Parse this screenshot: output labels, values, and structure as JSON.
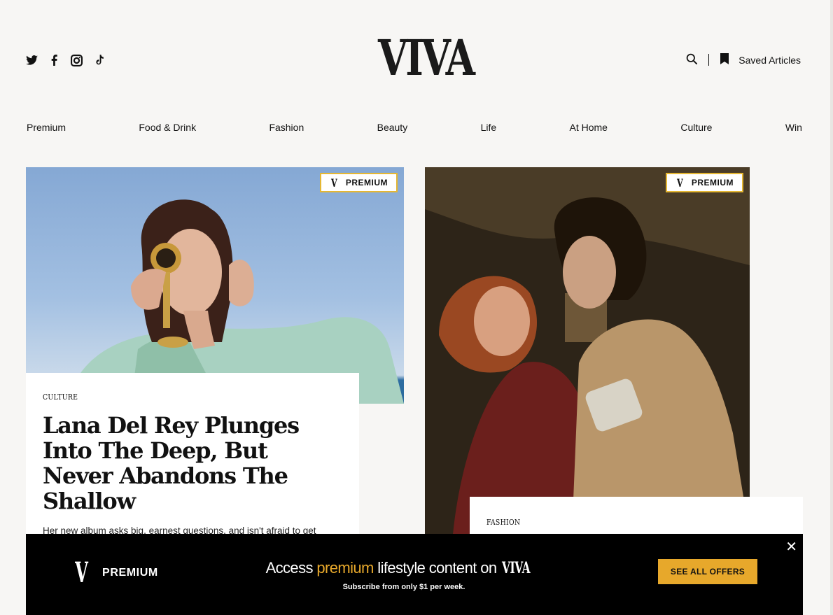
{
  "header": {
    "logo": "VIVA",
    "social_icons": [
      "twitter-icon",
      "facebook-icon",
      "instagram-icon",
      "tiktok-icon"
    ],
    "saved_articles_label": "Saved Articles"
  },
  "nav": {
    "items": [
      {
        "label": "Premium"
      },
      {
        "label": "Food & Drink"
      },
      {
        "label": "Fashion"
      },
      {
        "label": "Beauty"
      },
      {
        "label": "Life"
      },
      {
        "label": "At Home"
      },
      {
        "label": "Culture"
      },
      {
        "label": "Win"
      }
    ]
  },
  "articles": [
    {
      "badge_letter": "V",
      "badge": "PREMIUM",
      "category": "CULTURE",
      "headline": "Lana Del Rey Plunges Into The Deep, But Never Abandons The Shallow",
      "summary": "Her new album asks big, earnest questions, and isn't afraid to get messy."
    },
    {
      "badge_letter": "V",
      "badge": "PREMIUM",
      "category": "FASHION"
    }
  ],
  "banner": {
    "brand_letter": "V",
    "brand_label": "PREMIUM",
    "text_before": "Access ",
    "text_accent": "premium",
    "text_after": " lifestyle content on ",
    "text_brand": "VIVA",
    "subtext": "Subscribe from only $1 per week.",
    "button_label": "SEE ALL OFFERS",
    "close": "✕"
  },
  "colors": {
    "accent": "#e7a82b",
    "badge_border": "#e5b733",
    "page_bg": "#f7f6f4"
  }
}
